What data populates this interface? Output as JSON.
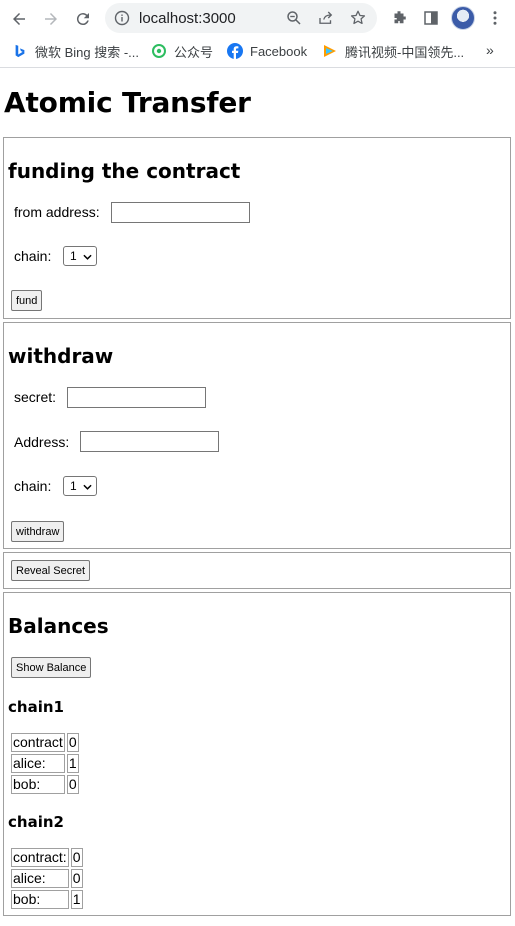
{
  "browser": {
    "url": "localhost:3000",
    "bookmarks": [
      {
        "label": "微软 Bing 搜索 -...",
        "icon": "bing-icon"
      },
      {
        "label": "公众号",
        "icon": "wechat-official-account-icon"
      },
      {
        "label": "Facebook",
        "icon": "facebook-icon"
      },
      {
        "label": "腾讯视频-中国领先...",
        "icon": "tencent-video-icon"
      }
    ],
    "more": "»"
  },
  "page": {
    "title": "Atomic Transfer"
  },
  "fund": {
    "heading": "funding the contract",
    "from_label": "from address:",
    "from_value": "",
    "chain_label": "chain:",
    "chain_value": "1",
    "button": "fund"
  },
  "withdraw": {
    "heading": "withdraw",
    "secret_label": "secret:",
    "secret_value": "",
    "address_label": "Address:",
    "address_value": "",
    "chain_label": "chain:",
    "chain_value": "1",
    "button": "withdraw"
  },
  "reveal": {
    "button": "Reveal Secret"
  },
  "balances": {
    "heading": "Balances",
    "button": "Show Balance",
    "chains": [
      {
        "title": "chain1",
        "rows": [
          {
            "name": "contract",
            "value": "0"
          },
          {
            "name": "alice:",
            "value": "1"
          },
          {
            "name": "bob:",
            "value": "0"
          }
        ]
      },
      {
        "title": "chain2",
        "rows": [
          {
            "name": "contract:",
            "value": "0"
          },
          {
            "name": "alice:",
            "value": "0"
          },
          {
            "name": "bob:",
            "value": "1"
          }
        ]
      }
    ]
  }
}
